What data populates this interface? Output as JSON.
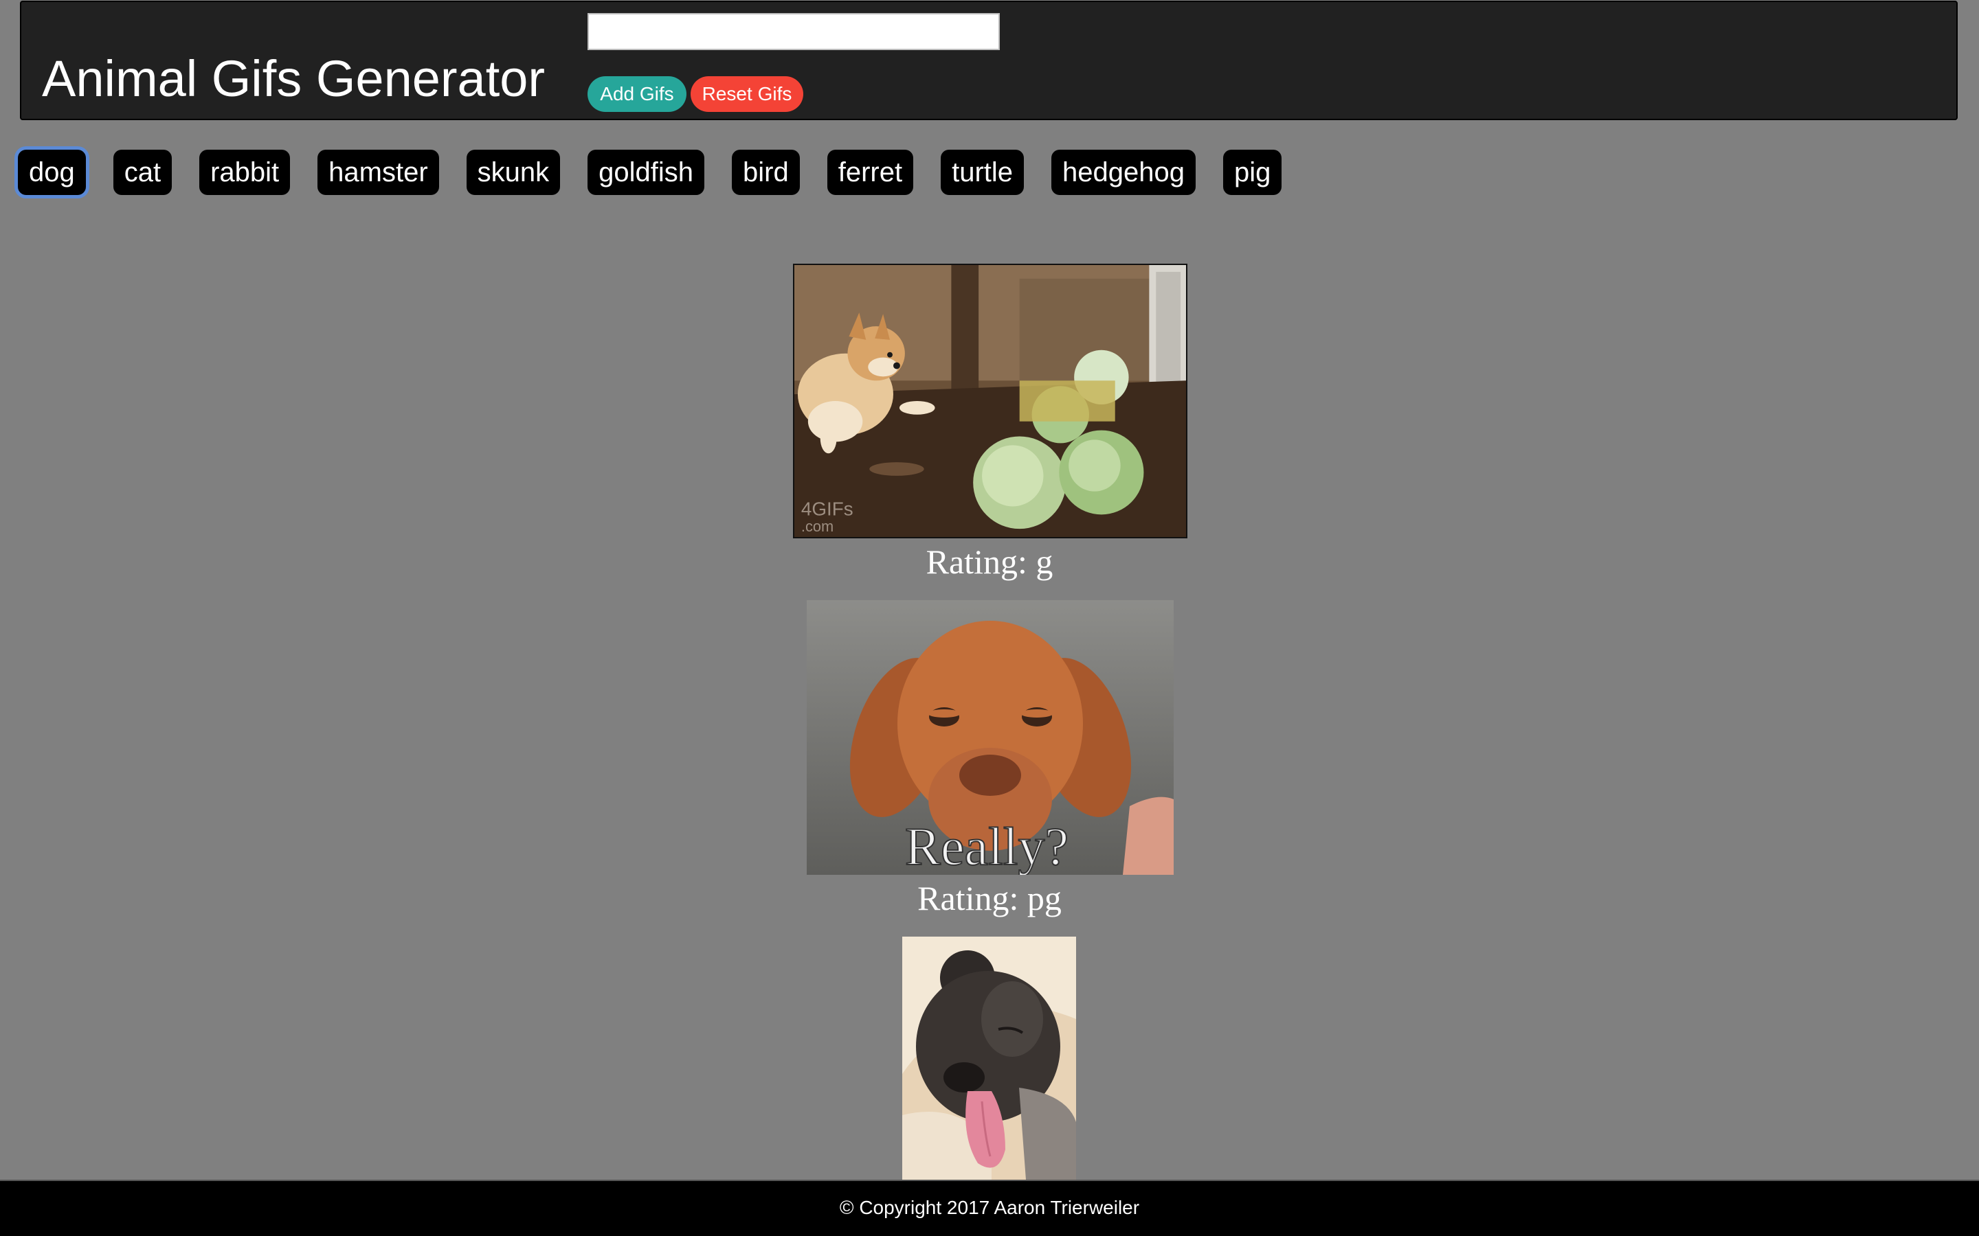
{
  "header": {
    "title": "Animal Gifs Generator",
    "input_value": "",
    "add_label": "Add Gifs",
    "reset_label": "Reset Gifs"
  },
  "animals": [
    {
      "label": "dog"
    },
    {
      "label": "cat"
    },
    {
      "label": "rabbit"
    },
    {
      "label": "hamster"
    },
    {
      "label": "skunk"
    },
    {
      "label": "goldfish"
    },
    {
      "label": "bird"
    },
    {
      "label": "ferret"
    },
    {
      "label": "turtle"
    },
    {
      "label": "hedgehog"
    },
    {
      "label": "pig"
    }
  ],
  "focused_animal": "dog",
  "gifs": [
    {
      "rating_text": "Rating: g",
      "watermark": "4GIFs .com",
      "subject": "corgi dog with cabbages"
    },
    {
      "rating_text": "Rating: pg",
      "caption": "Really?",
      "subject": "puppy dog"
    },
    {
      "rating_text": "",
      "subject": "sleeping dog with tongue out"
    }
  ],
  "footer": {
    "copyright": "© Copyright 2017 Aaron Trierweiler"
  },
  "colors": {
    "background": "#808080",
    "header_bg": "#212121",
    "add_button": "#26a69a",
    "reset_button": "#f44336",
    "animal_button": "#000000",
    "focus_ring": "#5b8ad6",
    "footer_bg": "#000000"
  }
}
